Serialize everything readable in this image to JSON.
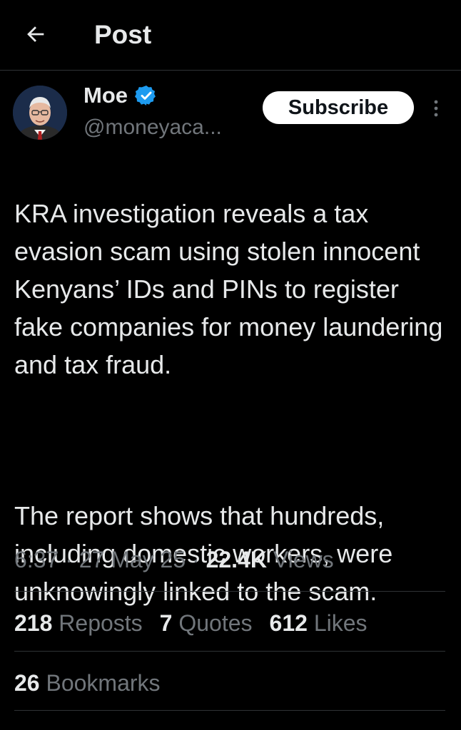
{
  "header": {
    "title": "Post",
    "back_icon": "arrow-left-icon"
  },
  "author": {
    "name": "Moe",
    "handle": "@moneyaca...",
    "verified_icon": "verified-badge-icon",
    "verified_color": "#1d9bf0"
  },
  "actions": {
    "subscribe_label": "Subscribe",
    "more_icon": "more-vertical-icon"
  },
  "post": {
    "paragraphs": [
      "KRA investigation reveals a tax evasion scam using stolen innocent Kenyans’ IDs and PINs to register fake companies for money laundering and tax fraud.",
      "The report shows that hundreds, including domestic workers, were unknowingly linked to the scam."
    ]
  },
  "meta": {
    "time": "6:37",
    "sep1": " · ",
    "date": "27 May 25",
    "sep2": " · ",
    "views_count": "22.4K",
    "views_label": " Views"
  },
  "stats": {
    "reposts_count": "218",
    "reposts_label": " Reposts",
    "quotes_count": "7",
    "quotes_label": " Quotes",
    "likes_count": "612",
    "likes_label": " Likes",
    "bookmarks_count": "26",
    "bookmarks_label": " Bookmarks"
  },
  "colors": {
    "background": "#000000",
    "text_primary": "#e7e9ea",
    "text_secondary": "#71767b",
    "divider": "#2f3336",
    "accent": "#1d9bf0"
  }
}
